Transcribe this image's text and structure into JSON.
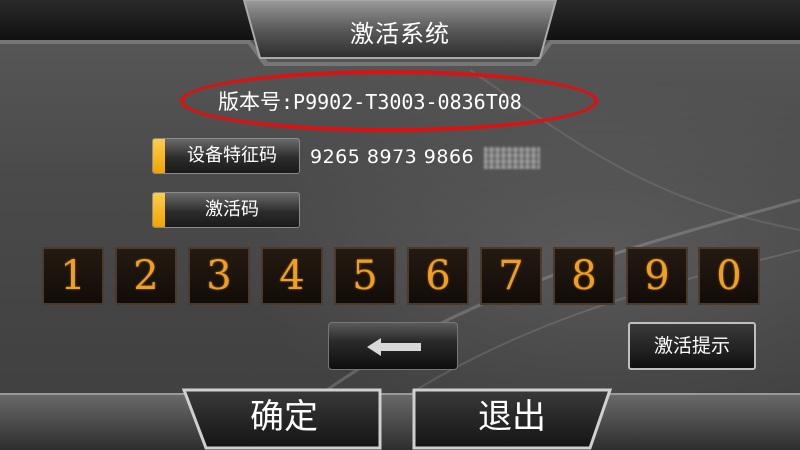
{
  "window": {
    "title": "激活系统"
  },
  "version": {
    "label": "版本号",
    "value": ":P9902-T3003-0836T08"
  },
  "device": {
    "label": "设备特征码",
    "code": "9265 8973 9866",
    "masked_part": "blurred"
  },
  "activation": {
    "label": "激活码"
  },
  "keypad": {
    "keys": [
      "1",
      "2",
      "3",
      "4",
      "5",
      "6",
      "7",
      "8",
      "9",
      "0"
    ]
  },
  "controls": {
    "backspace_icon": "left-arrow-icon",
    "hint_label": "激活提示",
    "confirm_label": "确定",
    "exit_label": "退出"
  },
  "colors": {
    "accent_orange": "#f0a020",
    "highlight_red": "#e01010",
    "label_accent": "#f0a400"
  }
}
